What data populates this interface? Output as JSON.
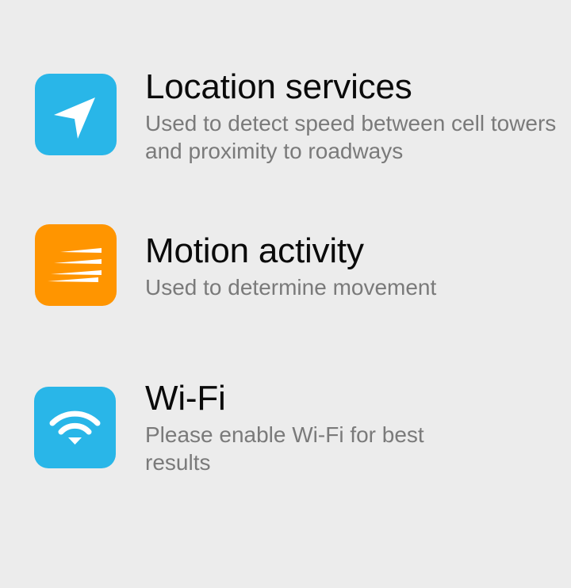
{
  "permissions": [
    {
      "title": "Location services",
      "description": "Used to detect speed between cell towers and proximity to roadways",
      "icon": "location-arrow-icon",
      "color": "#29b6e8"
    },
    {
      "title": "Motion activity",
      "description": "Used to determine movement",
      "icon": "motion-lines-icon",
      "color": "#ff9500"
    },
    {
      "title": "Wi-Fi",
      "description": "Please enable Wi-Fi for best results",
      "icon": "wifi-icon",
      "color": "#29b6e8"
    }
  ]
}
